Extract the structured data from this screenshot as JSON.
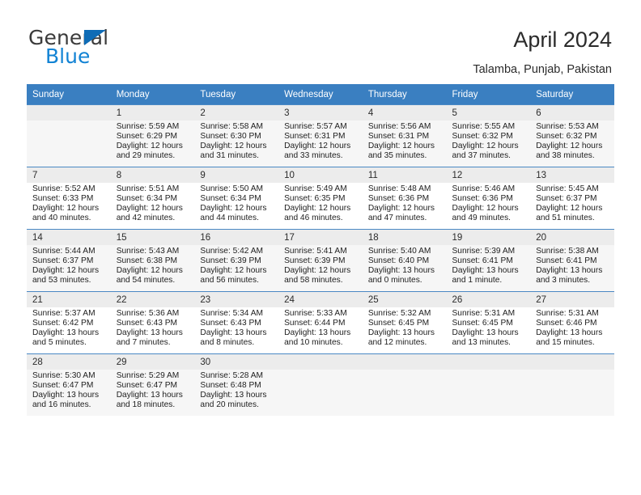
{
  "brand": {
    "name_part1": "General",
    "name_part2": "Blue",
    "triangle_icon": "triangle-icon",
    "accent_color": "#1283d4",
    "header_color": "#3a7fc1"
  },
  "header": {
    "title": "April 2024",
    "subtitle": "Talamba, Punjab, Pakistan"
  },
  "calendar": {
    "weekday_headers": [
      "Sunday",
      "Monday",
      "Tuesday",
      "Wednesday",
      "Thursday",
      "Friday",
      "Saturday"
    ],
    "weeks": [
      [
        {
          "day": "",
          "sunrise": "",
          "sunset": "",
          "daylight": "",
          "empty": true
        },
        {
          "day": "1",
          "sunrise": "Sunrise: 5:59 AM",
          "sunset": "Sunset: 6:29 PM",
          "daylight": "Daylight: 12 hours and 29 minutes."
        },
        {
          "day": "2",
          "sunrise": "Sunrise: 5:58 AM",
          "sunset": "Sunset: 6:30 PM",
          "daylight": "Daylight: 12 hours and 31 minutes."
        },
        {
          "day": "3",
          "sunrise": "Sunrise: 5:57 AM",
          "sunset": "Sunset: 6:31 PM",
          "daylight": "Daylight: 12 hours and 33 minutes."
        },
        {
          "day": "4",
          "sunrise": "Sunrise: 5:56 AM",
          "sunset": "Sunset: 6:31 PM",
          "daylight": "Daylight: 12 hours and 35 minutes."
        },
        {
          "day": "5",
          "sunrise": "Sunrise: 5:55 AM",
          "sunset": "Sunset: 6:32 PM",
          "daylight": "Daylight: 12 hours and 37 minutes."
        },
        {
          "day": "6",
          "sunrise": "Sunrise: 5:53 AM",
          "sunset": "Sunset: 6:32 PM",
          "daylight": "Daylight: 12 hours and 38 minutes."
        }
      ],
      [
        {
          "day": "7",
          "sunrise": "Sunrise: 5:52 AM",
          "sunset": "Sunset: 6:33 PM",
          "daylight": "Daylight: 12 hours and 40 minutes."
        },
        {
          "day": "8",
          "sunrise": "Sunrise: 5:51 AM",
          "sunset": "Sunset: 6:34 PM",
          "daylight": "Daylight: 12 hours and 42 minutes."
        },
        {
          "day": "9",
          "sunrise": "Sunrise: 5:50 AM",
          "sunset": "Sunset: 6:34 PM",
          "daylight": "Daylight: 12 hours and 44 minutes."
        },
        {
          "day": "10",
          "sunrise": "Sunrise: 5:49 AM",
          "sunset": "Sunset: 6:35 PM",
          "daylight": "Daylight: 12 hours and 46 minutes."
        },
        {
          "day": "11",
          "sunrise": "Sunrise: 5:48 AM",
          "sunset": "Sunset: 6:36 PM",
          "daylight": "Daylight: 12 hours and 47 minutes."
        },
        {
          "day": "12",
          "sunrise": "Sunrise: 5:46 AM",
          "sunset": "Sunset: 6:36 PM",
          "daylight": "Daylight: 12 hours and 49 minutes."
        },
        {
          "day": "13",
          "sunrise": "Sunrise: 5:45 AM",
          "sunset": "Sunset: 6:37 PM",
          "daylight": "Daylight: 12 hours and 51 minutes."
        }
      ],
      [
        {
          "day": "14",
          "sunrise": "Sunrise: 5:44 AM",
          "sunset": "Sunset: 6:37 PM",
          "daylight": "Daylight: 12 hours and 53 minutes."
        },
        {
          "day": "15",
          "sunrise": "Sunrise: 5:43 AM",
          "sunset": "Sunset: 6:38 PM",
          "daylight": "Daylight: 12 hours and 54 minutes."
        },
        {
          "day": "16",
          "sunrise": "Sunrise: 5:42 AM",
          "sunset": "Sunset: 6:39 PM",
          "daylight": "Daylight: 12 hours and 56 minutes."
        },
        {
          "day": "17",
          "sunrise": "Sunrise: 5:41 AM",
          "sunset": "Sunset: 6:39 PM",
          "daylight": "Daylight: 12 hours and 58 minutes."
        },
        {
          "day": "18",
          "sunrise": "Sunrise: 5:40 AM",
          "sunset": "Sunset: 6:40 PM",
          "daylight": "Daylight: 13 hours and 0 minutes."
        },
        {
          "day": "19",
          "sunrise": "Sunrise: 5:39 AM",
          "sunset": "Sunset: 6:41 PM",
          "daylight": "Daylight: 13 hours and 1 minute."
        },
        {
          "day": "20",
          "sunrise": "Sunrise: 5:38 AM",
          "sunset": "Sunset: 6:41 PM",
          "daylight": "Daylight: 13 hours and 3 minutes."
        }
      ],
      [
        {
          "day": "21",
          "sunrise": "Sunrise: 5:37 AM",
          "sunset": "Sunset: 6:42 PM",
          "daylight": "Daylight: 13 hours and 5 minutes."
        },
        {
          "day": "22",
          "sunrise": "Sunrise: 5:36 AM",
          "sunset": "Sunset: 6:43 PM",
          "daylight": "Daylight: 13 hours and 7 minutes."
        },
        {
          "day": "23",
          "sunrise": "Sunrise: 5:34 AM",
          "sunset": "Sunset: 6:43 PM",
          "daylight": "Daylight: 13 hours and 8 minutes."
        },
        {
          "day": "24",
          "sunrise": "Sunrise: 5:33 AM",
          "sunset": "Sunset: 6:44 PM",
          "daylight": "Daylight: 13 hours and 10 minutes."
        },
        {
          "day": "25",
          "sunrise": "Sunrise: 5:32 AM",
          "sunset": "Sunset: 6:45 PM",
          "daylight": "Daylight: 13 hours and 12 minutes."
        },
        {
          "day": "26",
          "sunrise": "Sunrise: 5:31 AM",
          "sunset": "Sunset: 6:45 PM",
          "daylight": "Daylight: 13 hours and 13 minutes."
        },
        {
          "day": "27",
          "sunrise": "Sunrise: 5:31 AM",
          "sunset": "Sunset: 6:46 PM",
          "daylight": "Daylight: 13 hours and 15 minutes."
        }
      ],
      [
        {
          "day": "28",
          "sunrise": "Sunrise: 5:30 AM",
          "sunset": "Sunset: 6:47 PM",
          "daylight": "Daylight: 13 hours and 16 minutes."
        },
        {
          "day": "29",
          "sunrise": "Sunrise: 5:29 AM",
          "sunset": "Sunset: 6:47 PM",
          "daylight": "Daylight: 13 hours and 18 minutes."
        },
        {
          "day": "30",
          "sunrise": "Sunrise: 5:28 AM",
          "sunset": "Sunset: 6:48 PM",
          "daylight": "Daylight: 13 hours and 20 minutes."
        },
        {
          "day": "",
          "sunrise": "",
          "sunset": "",
          "daylight": "",
          "empty": true
        },
        {
          "day": "",
          "sunrise": "",
          "sunset": "",
          "daylight": "",
          "empty": true
        },
        {
          "day": "",
          "sunrise": "",
          "sunset": "",
          "daylight": "",
          "empty": true
        },
        {
          "day": "",
          "sunrise": "",
          "sunset": "",
          "daylight": "",
          "empty": true
        }
      ]
    ]
  }
}
